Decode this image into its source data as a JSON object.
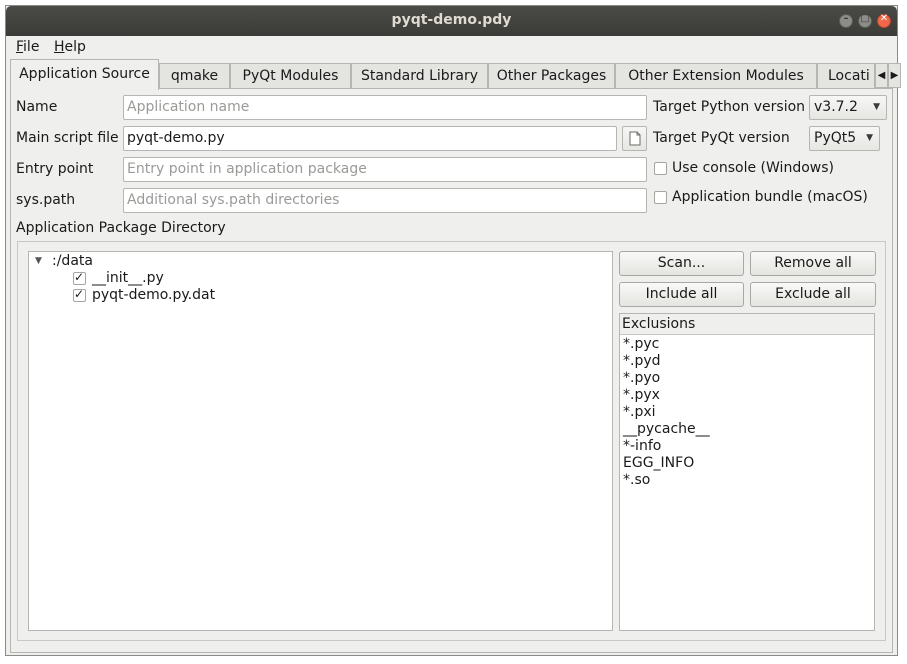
{
  "window": {
    "title": "pyqt-demo.pdy"
  },
  "menu": {
    "file": "File",
    "help": "Help"
  },
  "tabs": [
    {
      "label": "Application Source"
    },
    {
      "label": "qmake"
    },
    {
      "label": "PyQt Modules"
    },
    {
      "label": "Standard Library"
    },
    {
      "label": "Other Packages"
    },
    {
      "label": "Other Extension Modules"
    },
    {
      "label": "Locati"
    }
  ],
  "form": {
    "name_label": "Name",
    "name_placeholder": "Application name",
    "main_script_label": "Main script file",
    "main_script_value": "pyqt-demo.py",
    "entry_point_label": "Entry point",
    "entry_point_placeholder": "Entry point in application package",
    "sys_path_label": "sys.path",
    "sys_path_placeholder": "Additional sys.path directories",
    "target_python_label": "Target Python version",
    "target_python_value": "v3.7.2",
    "target_pyqt_label": "Target PyQt version",
    "target_pyqt_value": "PyQt5",
    "use_console_label": "Use console (Windows)",
    "use_console_checked": false,
    "app_bundle_label": "Application bundle (macOS)",
    "app_bundle_checked": false
  },
  "package": {
    "section_label": "Application Package Directory",
    "root": ":/data",
    "files": [
      {
        "name": "__init__.py",
        "checked": true
      },
      {
        "name": "pyqt-demo.py.dat",
        "checked": true
      }
    ],
    "scan_label": "Scan...",
    "remove_all_label": "Remove all",
    "include_all_label": "Include all",
    "exclude_all_label": "Exclude all",
    "exclusions_header": "Exclusions",
    "exclusions": [
      "*.pyc",
      "*.pyd",
      "*.pyo",
      "*.pyx",
      "*.pxi",
      "__pycache__",
      "*-info",
      "EGG_INFO",
      "*.so"
    ]
  }
}
